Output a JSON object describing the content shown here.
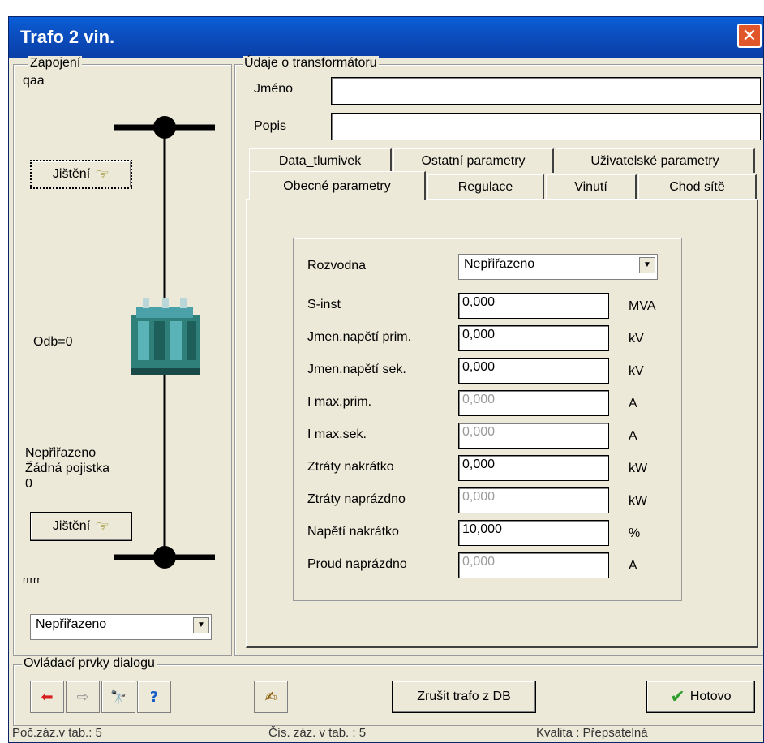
{
  "window": {
    "title": "Trafo 2 vin.",
    "close_icon": "close-icon",
    "close_glyph": "✕"
  },
  "zapojeni": {
    "legend": "Zapojení",
    "name": "qaa",
    "jisteni_top": "Jištění",
    "odb": "Odb=0",
    "status_lines": [
      "Nepřiřazeno",
      "Žádná pojistka",
      "0"
    ],
    "jisteni_bottom": "Jištění",
    "bottom_label": "rrrrr",
    "select_value": "Nepřiřazeno",
    "hand_glyph": "☞"
  },
  "udaje": {
    "legend": "Údaje o transformátoru",
    "jmeno_label": "Jméno",
    "jmeno_value": "",
    "popis_label": "Popis",
    "popis_value": ""
  },
  "tabs": {
    "row1": [
      "Data_tlumivek",
      "Ostatní parametry",
      "Uživatelské parametry"
    ],
    "row2": [
      "Obecné parametry",
      "Regulace",
      "Vinutí",
      "Chod sítě"
    ],
    "active": "Obecné parametry"
  },
  "params": {
    "rozvodna_label": "Rozvodna",
    "rozvodna_value": "Nepřiřazeno",
    "rows": [
      {
        "label": "S-inst",
        "value": "0,000",
        "unit": "MVA",
        "disabled": false
      },
      {
        "label": "Jmen.napětí prim.",
        "value": "0,000",
        "unit": "kV",
        "disabled": false
      },
      {
        "label": "Jmen.napětí sek.",
        "value": "0,000",
        "unit": "kV",
        "disabled": false
      },
      {
        "label": "I max.prim.",
        "value": "0,000",
        "unit": "A",
        "disabled": true
      },
      {
        "label": "I max.sek.",
        "value": "0,000",
        "unit": "A",
        "disabled": true
      },
      {
        "label": "Ztráty nakrátko",
        "value": "0,000",
        "unit": "kW",
        "disabled": false
      },
      {
        "label": "Ztráty naprázdno",
        "value": "0,000",
        "unit": "kW",
        "disabled": true
      },
      {
        "label": "Napětí nakrátko",
        "value": "10,000",
        "unit": "%",
        "disabled": false
      },
      {
        "label": "Proud naprázdno",
        "value": "0,000",
        "unit": "A",
        "disabled": true
      }
    ]
  },
  "controls": {
    "legend": "Ovládací prvky dialogu",
    "prev_glyph": "⬅",
    "next_glyph": "⇨",
    "find_glyph": "🔭",
    "info_glyph": "?",
    "edit_glyph": "✍",
    "delete_label": "Zrušit trafo z DB",
    "done_label": "Hotovo",
    "done_glyph": "✔"
  },
  "statusbar": [
    "Poč.záz.v tab.: 5",
    "Čís. záz. v tab. : 5",
    "Kvalita : Přepsatelná"
  ],
  "colors": {
    "title_bg": "#0b4fc0",
    "dialog_bg": "#ece9d8",
    "accent_red": "#d81e1e",
    "ok_green": "#2e9e2e"
  }
}
